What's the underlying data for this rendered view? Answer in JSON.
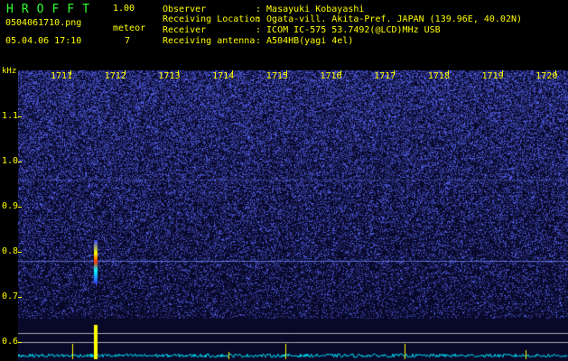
{
  "header": {
    "title": "HROFFT",
    "version": "1.00",
    "filename": "0504061710.png",
    "datetime": "05.04.06 17:10",
    "meteor_label": "meteor",
    "meteor_count": "7",
    "info": [
      {
        "label": "Observer",
        "value": ": Masayuki Kobayashi"
      },
      {
        "label": "Receiving Location",
        "value": ": Ogata-vill. Akita-Pref. JAPAN (139.96E, 40.02N)"
      },
      {
        "label": "Receiver",
        "value": ": ICOM IC-575 53.7492(@LCD)MHz USB"
      },
      {
        "label": "Receiving antenna",
        "value": ": A504HB(yagi 4el)"
      }
    ]
  },
  "axis": {
    "unit": "kHz",
    "x_ticks": [
      "1711",
      "1712",
      "1713",
      "1714",
      "1715",
      "1716",
      "1717",
      "1718",
      "1719",
      "1720"
    ],
    "y_ticks": [
      "1.1",
      "1.0",
      "0.9",
      "0.8",
      "0.7",
      "0.6"
    ]
  },
  "colors": {
    "text": "#ffff00",
    "title": "#33ff33",
    "background": "#0a0a2e",
    "noise": "#3a4aff",
    "trace": "#00e5ff"
  }
}
